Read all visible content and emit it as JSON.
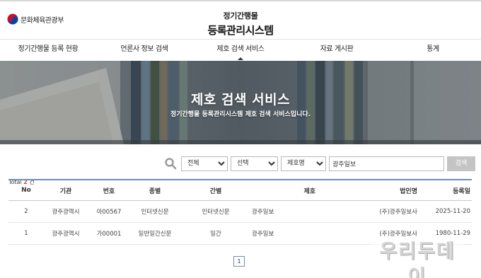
{
  "header": {
    "ministry_name": "문화체육관광부",
    "title_line1": "정기간행물",
    "title_line2": "등록관리시스템"
  },
  "nav": [
    {
      "label": "정기간행물 등록 현황",
      "active": false
    },
    {
      "label": "언론사 정보 검색",
      "active": false
    },
    {
      "label": "제호 검색 서비스",
      "active": true
    },
    {
      "label": "자료 게시판",
      "active": false
    },
    {
      "label": "통계",
      "active": false
    }
  ],
  "banner": {
    "title": "제호 검색 서비스",
    "subtitle": "정기간행물 등록관리시스템 제호 검색 서비스입니다."
  },
  "search": {
    "filter1": "전체",
    "filter2": "선택",
    "filter3": "제호명",
    "query": "광주일보",
    "button": "검색"
  },
  "total": {
    "prefix": "Total",
    "count": "2",
    "suffix": "건"
  },
  "table": {
    "headers": [
      "No",
      "기관",
      "번호",
      "종별",
      "간별",
      "제호",
      "법인명",
      "등록일"
    ],
    "rows": [
      [
        "2",
        "광주광역시",
        "아00567",
        "인터넷신문",
        "인터넷신문",
        "광주일보",
        "(주)광주일보사",
        "2025-11-20"
      ],
      [
        "1",
        "광주광역시",
        "가00001",
        "일반일간신문",
        "일간",
        "광주일보",
        "(주)광주일보사",
        "1980-11-29"
      ]
    ]
  },
  "pagination": {
    "current": "1"
  },
  "watermark": {
    "text": "우리두데이"
  },
  "colors": {
    "accent": "#6b8fb5",
    "count": "#e23b3b",
    "button": "#c4c4c4"
  }
}
